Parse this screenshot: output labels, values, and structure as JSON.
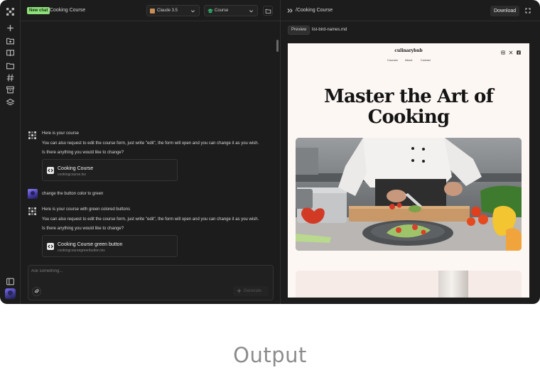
{
  "chat": {
    "badge": "New chat",
    "title": "/Cooking Course",
    "model_dropdown": {
      "label": "Claude 3.5",
      "icon": "claude-icon"
    },
    "project_dropdown": {
      "label": "Course",
      "icon": "graduation-cap-icon"
    },
    "messages": [
      {
        "role": "assistant",
        "lines": [
          "Here is your course",
          "You can also request to edit the course form, just write \"edit\", the form will open and you can change it as you wish.",
          "Is there anything you would like to change?"
        ],
        "file": {
          "title": "Cooking Course",
          "filename": "cookingcourse.tsx"
        }
      },
      {
        "role": "user",
        "text": "change the button color to green"
      },
      {
        "role": "assistant",
        "lines": [
          "Here is your course with green colored buttons",
          "You can also request to edit the course form, just write \"edit\", the form will open and you can change it as you wish.",
          "Is there anything you would like to change?"
        ],
        "file": {
          "title": "Cooking Course green button",
          "filename": "cookingcoursegreenbutton.tsx"
        }
      }
    ],
    "composer": {
      "placeholder": "Ask something...",
      "generate_label": "Generate"
    }
  },
  "preview": {
    "title": "/Cooking Course",
    "download_label": "Download",
    "tabs": [
      {
        "label": "Preview",
        "active": true
      },
      {
        "label": "list-bird-names.md",
        "active": false
      }
    ],
    "site": {
      "logo": "culinaryhub",
      "nav": [
        "Courses",
        "About",
        "Contact"
      ],
      "social_icons": [
        "instagram-icon",
        "x-icon",
        "facebook-icon"
      ],
      "hero_line1": "Master the Art of",
      "hero_line2": "Cooking"
    }
  },
  "caption": "Output",
  "colors": {
    "app_bg": "#1c1c1c",
    "new_chat_badge": "#8ee07a",
    "site_bg": "#fdf7f4",
    "caption": "#8c8c8c"
  }
}
